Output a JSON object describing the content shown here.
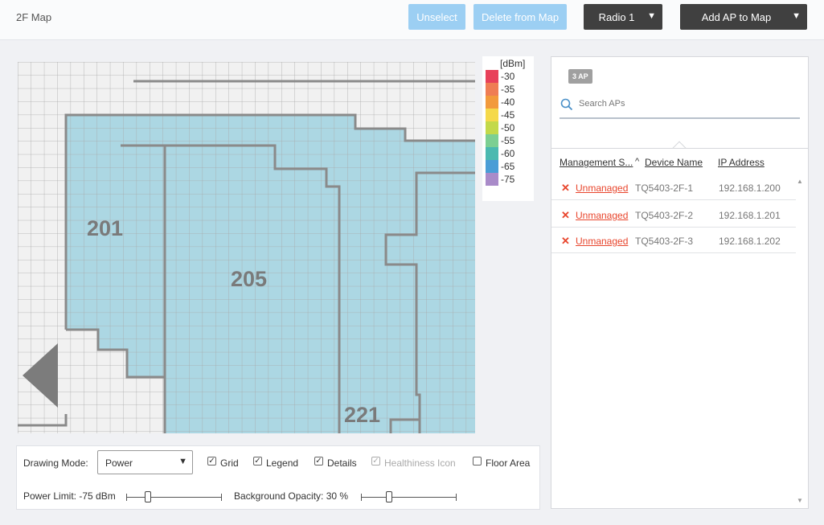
{
  "header": {
    "title": "2F Map",
    "unselect_label": "Unselect",
    "delete_label": "Delete from Map",
    "radio_label": "Radio 1",
    "add_ap_label": "Add AP to Map"
  },
  "map": {
    "room_labels": [
      "201",
      "205",
      "221"
    ],
    "coverage_color": "#acd7e3",
    "wall_color": "#8a8a8a"
  },
  "legend": {
    "unit": "[dBm]",
    "items": [
      {
        "label": "-30",
        "color": "#e8415a"
      },
      {
        "label": "-35",
        "color": "#ef7d54"
      },
      {
        "label": "-40",
        "color": "#f29a3c"
      },
      {
        "label": "-45",
        "color": "#f5d94a"
      },
      {
        "label": "-50",
        "color": "#c3d94a"
      },
      {
        "label": "-55",
        "color": "#7ccf92"
      },
      {
        "label": "-60",
        "color": "#4bb9b0"
      },
      {
        "label": "-65",
        "color": "#4a9dd6"
      },
      {
        "label": "-75",
        "color": "#a98bc9"
      }
    ]
  },
  "controls": {
    "drawing_mode_label": "Drawing Mode:",
    "drawing_mode_value": "Power",
    "grid": {
      "label": "Grid",
      "checked": true
    },
    "legend": {
      "label": "Legend",
      "checked": true
    },
    "details": {
      "label": "Details",
      "checked": true
    },
    "healthiness": {
      "label": "Healthiness Icon",
      "checked": true
    },
    "floor_area": {
      "label": "Floor Area",
      "checked": false
    },
    "power_limit_label": "Power Limit: -75 dBm",
    "power_limit_fraction": 0.23,
    "bg_opacity_label": "Background Opacity: 30 %",
    "bg_opacity_fraction": 0.3
  },
  "ap_panel": {
    "badge": "3 AP",
    "search_placeholder": "Search APs",
    "columns": [
      "Management S...",
      "Device Name",
      "IP Address"
    ],
    "sort_indicator": "^",
    "rows": [
      {
        "status": "Unmanaged",
        "device": "TQ5403-2F-1",
        "ip": "192.168.1.200"
      },
      {
        "status": "Unmanaged",
        "device": "TQ5403-2F-2",
        "ip": "192.168.1.201"
      },
      {
        "status": "Unmanaged",
        "device": "TQ5403-2F-3",
        "ip": "192.168.1.202"
      }
    ]
  }
}
